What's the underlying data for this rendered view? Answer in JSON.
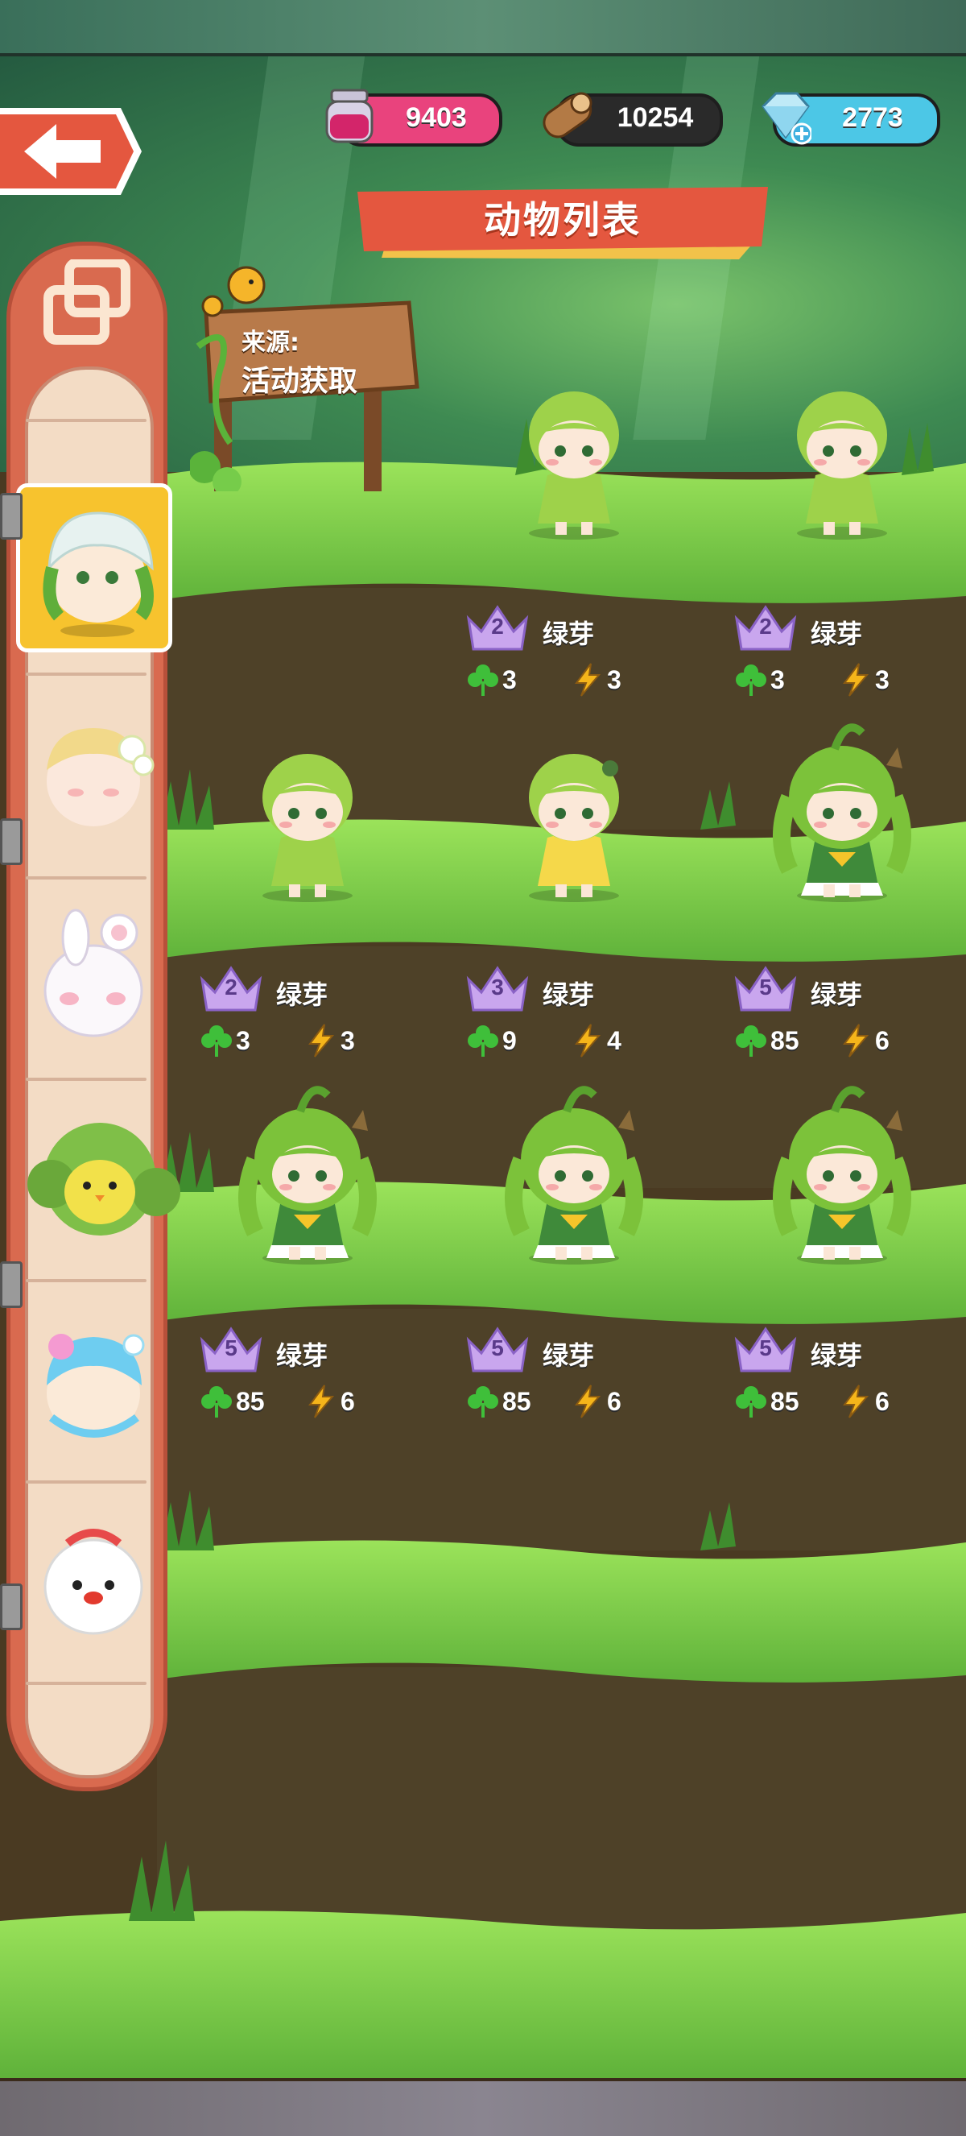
{
  "resources": [
    {
      "icon": "jar-icon",
      "value": "9403",
      "color": "#e9437d"
    },
    {
      "icon": "wood-log-icon",
      "value": "10254",
      "color": "#2a2a2a"
    },
    {
      "icon": "diamond-icon",
      "value": "2773",
      "color": "#4cc7e6"
    }
  ],
  "header": {
    "title": "动物列表"
  },
  "source": {
    "label": "来源:",
    "value": "活动获取"
  },
  "sidebar": {
    "menu_icon": "collection-icon",
    "animals": [
      {
        "name": "green-sprout-cap-avatar",
        "selected": true
      },
      {
        "name": "blonde-flower-avatar",
        "selected": false
      },
      {
        "name": "white-bunny-avatar",
        "selected": false
      },
      {
        "name": "yellow-chick-bush-avatar",
        "selected": false
      },
      {
        "name": "blue-flower-avatar",
        "selected": false
      },
      {
        "name": "white-bird-avatar",
        "selected": false
      }
    ]
  },
  "animals": [
    {
      "level": "2",
      "name": "绿芽",
      "clover": "3",
      "energy": "3",
      "variant": "sprout"
    },
    {
      "level": "2",
      "name": "绿芽",
      "clover": "3",
      "energy": "3",
      "variant": "sprout"
    },
    {
      "level": "2",
      "name": "绿芽",
      "clover": "3",
      "energy": "3",
      "variant": "sprout"
    },
    {
      "level": "3",
      "name": "绿芽",
      "clover": "9",
      "energy": "4",
      "variant": "sprout-dress"
    },
    {
      "level": "5",
      "name": "绿芽",
      "clover": "85",
      "energy": "6",
      "variant": "sprout-full"
    },
    {
      "level": "5",
      "name": "绿芽",
      "clover": "85",
      "energy": "6",
      "variant": "sprout-full"
    },
    {
      "level": "5",
      "name": "绿芽",
      "clover": "85",
      "energy": "6",
      "variant": "sprout-full"
    },
    {
      "level": "5",
      "name": "绿芽",
      "clover": "85",
      "energy": "6",
      "variant": "sprout-full"
    }
  ],
  "icons": {
    "clover": "clover-icon",
    "energy": "lightning-icon",
    "level": "crown-icon",
    "back": "back-arrow-icon"
  },
  "colors": {
    "crown": "#c9a6ee",
    "selected_slot": "#f7c32e",
    "title_banner": "#e4573f",
    "grass": "#7dce46"
  }
}
